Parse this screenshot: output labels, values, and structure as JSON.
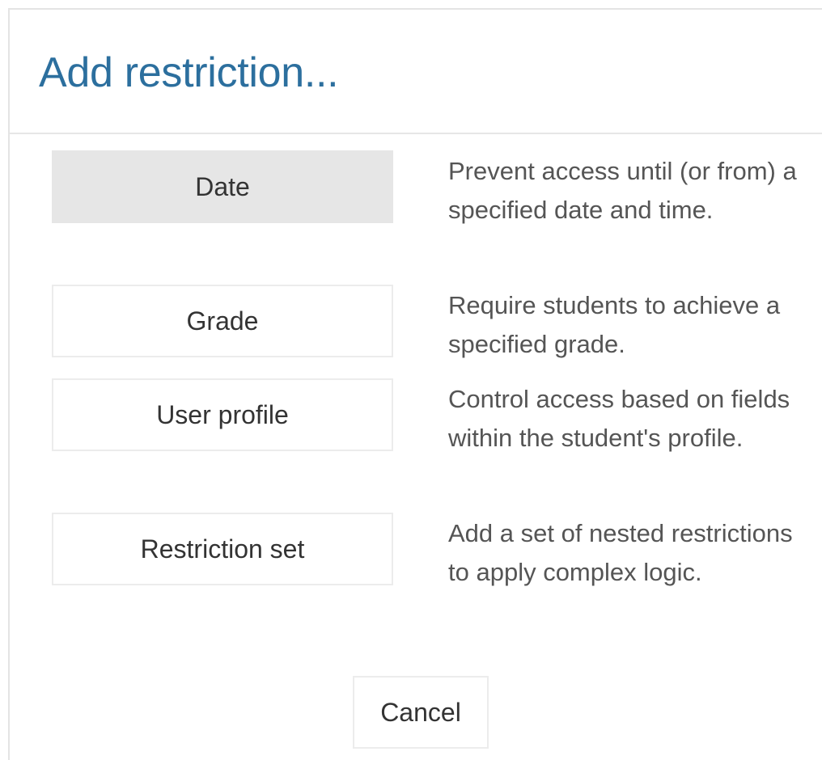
{
  "dialog": {
    "title": "Add restriction..."
  },
  "restrictions": [
    {
      "label": "Date",
      "description": "Prevent access until (or from) a specified date and time.",
      "selected": true
    },
    {
      "label": "Grade",
      "description": "Require students to achieve a specified grade.",
      "selected": false
    },
    {
      "label": "User profile",
      "description": "Control access based on fields within the student's profile.",
      "selected": false
    },
    {
      "label": "Restriction set",
      "description": "Add a set of nested restrictions to apply complex logic.",
      "selected": false
    }
  ],
  "actions": {
    "cancel_label": "Cancel"
  },
  "colors": {
    "title": "#2c6f9e",
    "selected_button_bg": "#e6e6e6",
    "button_border": "#ececec",
    "text": "#333333",
    "description_text": "#555555"
  }
}
